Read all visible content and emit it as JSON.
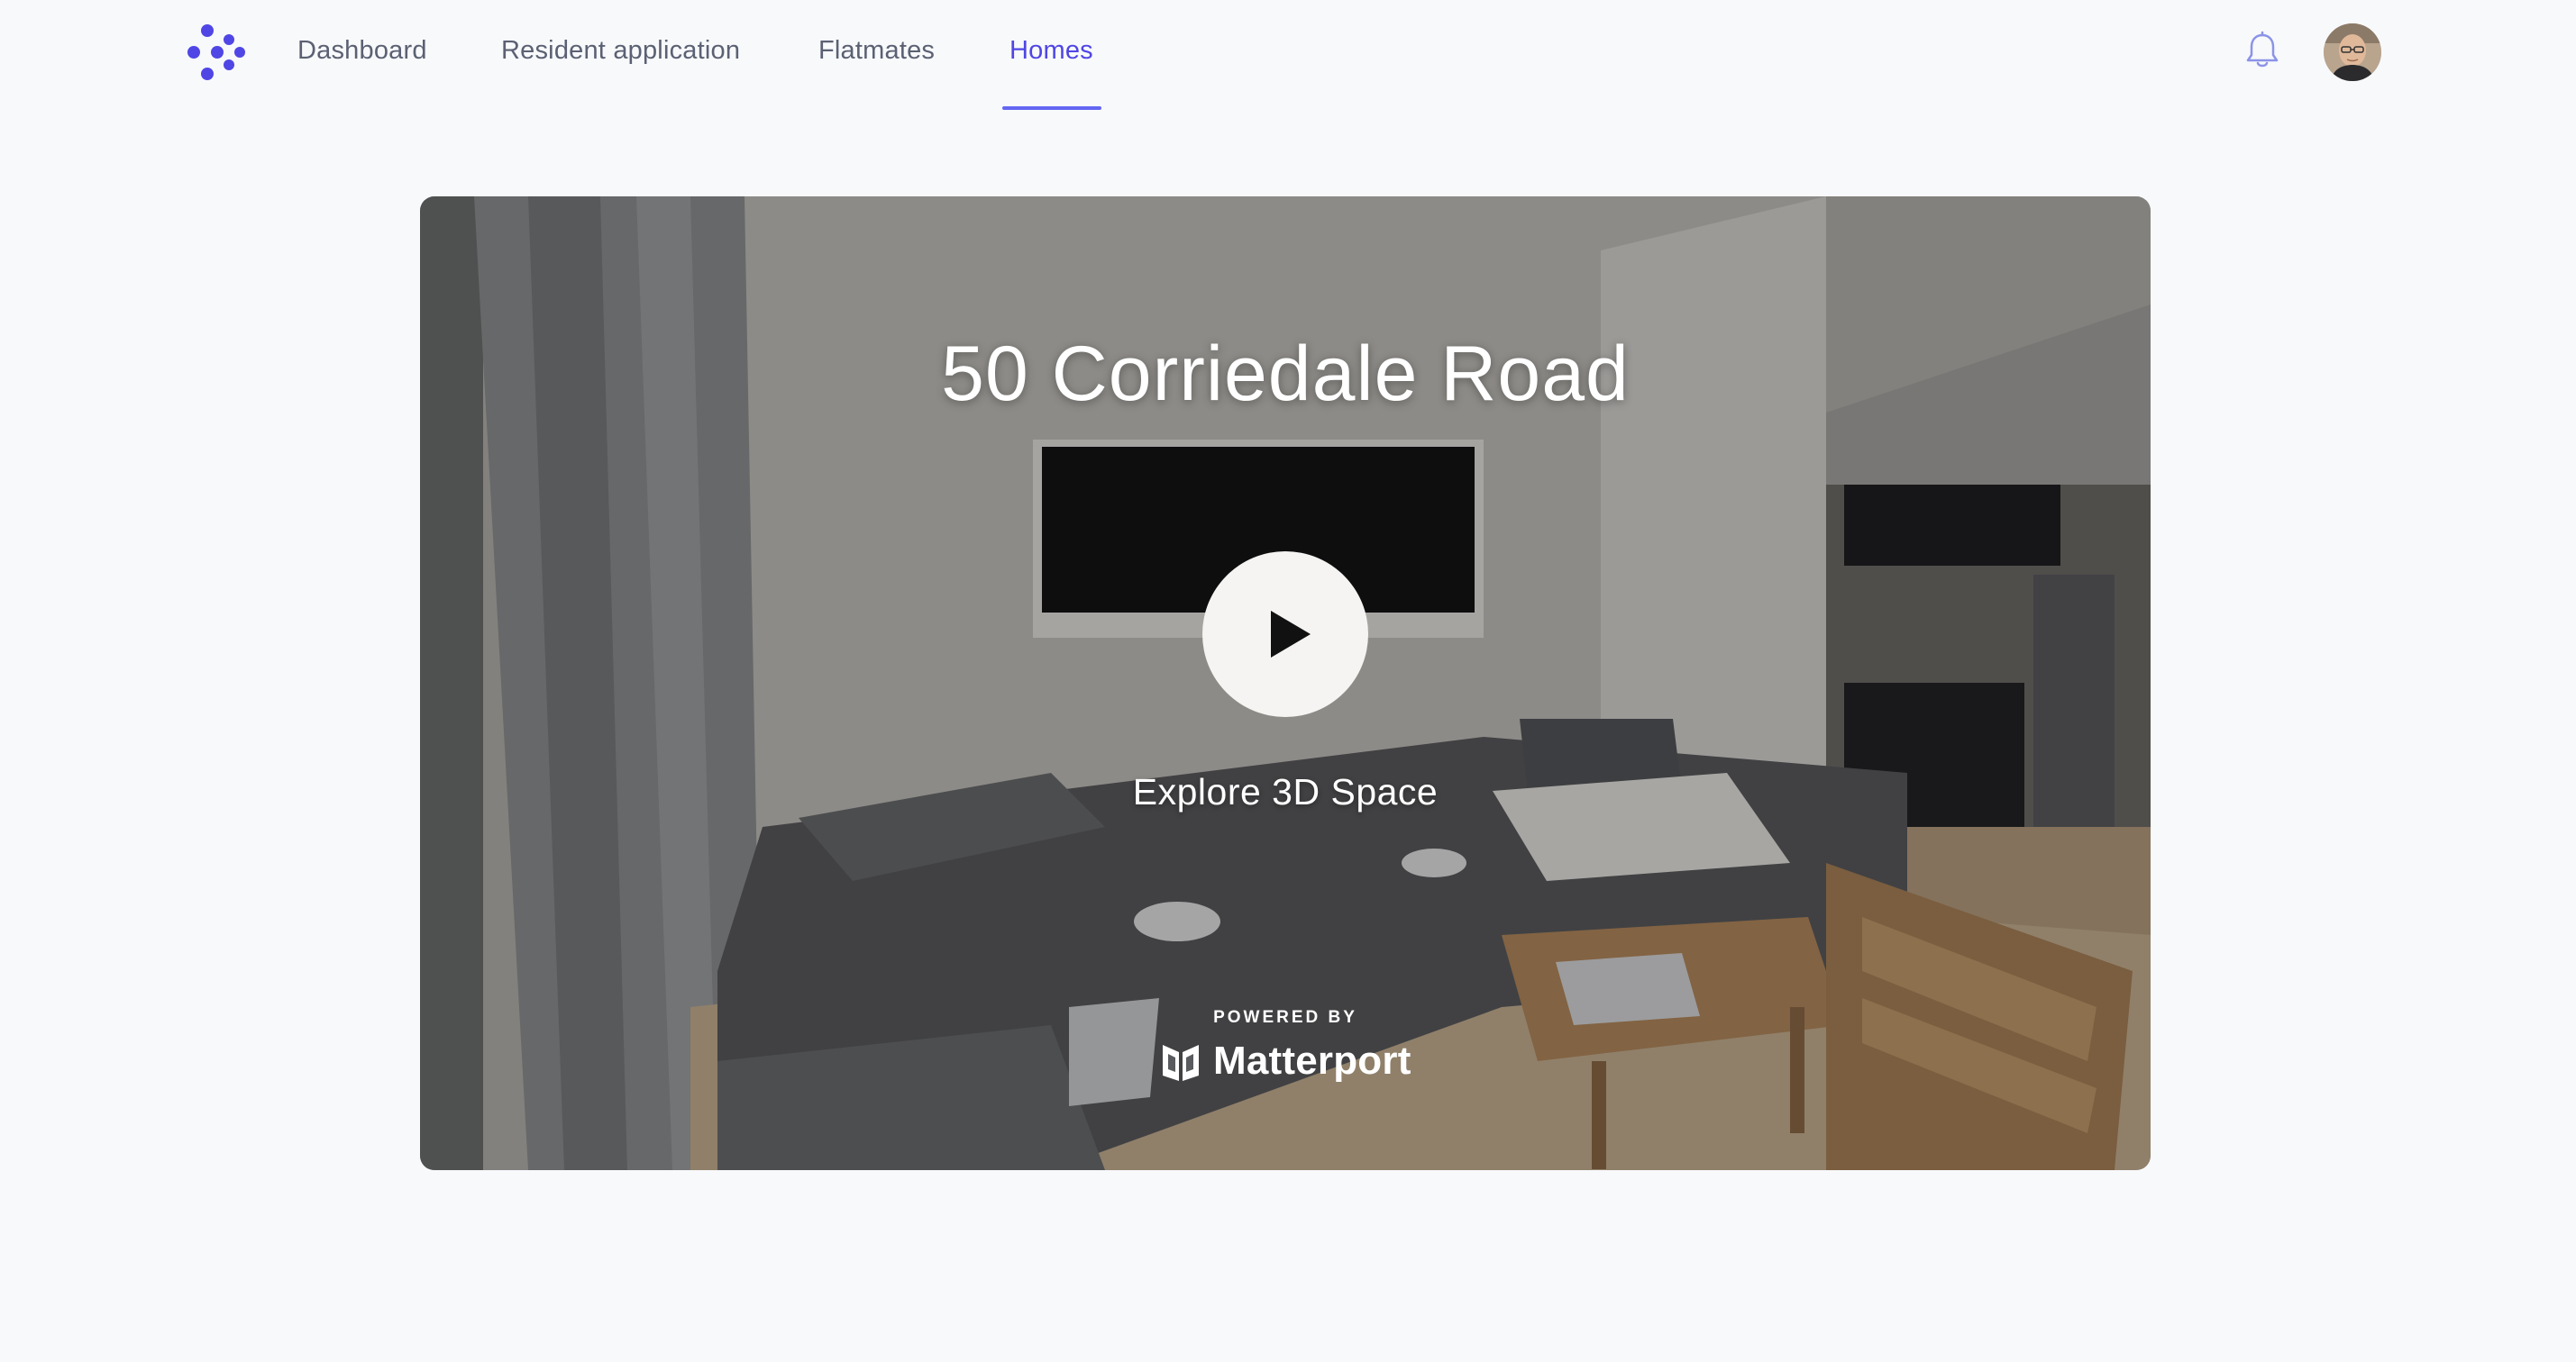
{
  "nav": {
    "items": [
      {
        "label": "Dashboard",
        "active": false
      },
      {
        "label": "Resident application",
        "active": false
      },
      {
        "label": "Flatmates",
        "active": false
      },
      {
        "label": "Homes",
        "active": true
      }
    ],
    "notifications_icon": "bell-icon",
    "brand_icon": "dots-logo-icon"
  },
  "viewer": {
    "title": "50 Corriedale Road",
    "action_label": "Explore 3D Space",
    "play_icon": "play-icon",
    "powered_by": "POWERED BY",
    "brand": "Matterport"
  },
  "colors": {
    "accent": "#4f46e5",
    "nav_text": "#5b6173",
    "background": "#f8f9fb"
  }
}
